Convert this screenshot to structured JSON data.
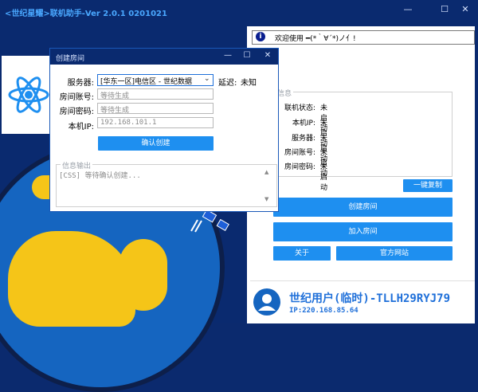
{
  "window": {
    "title": "<世纪星耀>联机助手-Ver 2.0.1 0201021",
    "min": "—",
    "max": "☐",
    "close": "✕"
  },
  "notice": {
    "icon": "i",
    "text": "欢迎使用 ━(*｀∀´*)ノ亻!"
  },
  "info": {
    "title": "信息",
    "rows": [
      {
        "key": "联机状态:",
        "value": "未启动"
      },
      {
        "key": "本机IP:",
        "value": "未启动"
      },
      {
        "key": "服务器:",
        "value": "未启动"
      },
      {
        "key": "房间账号:",
        "value": "未启动"
      },
      {
        "key": "房间密码:",
        "value": "未启动"
      }
    ]
  },
  "buttons": {
    "copy": "一键复制",
    "create_room": "创建房间",
    "join_room": "加入房间",
    "about": "关于",
    "website": "官方网站"
  },
  "user": {
    "name": "世纪用户(临时)-TLLH29RYJ79",
    "ip": "IP:220.168.85.64"
  },
  "dialog": {
    "title": "创建房间",
    "min": "—",
    "max": "☐",
    "close": "✕",
    "server_label": "服务器:",
    "server_value": "[华东一区]电信区 - 世纪数据",
    "latency_label": "延迟:",
    "latency_value": "未知",
    "room_account_label": "房间账号:",
    "room_account_placeholder": "等待生成",
    "room_password_label": "房间密码:",
    "room_password_placeholder": "等待生成",
    "local_ip_label": "本机IP:",
    "local_ip_value": "192.168.101.1",
    "confirm": "确认创建",
    "log_title": "信息输出",
    "log_text": "[CSS] 等待确认创建..."
  },
  "colors": {
    "accent": "#1e8ff0",
    "title_bar": "#0a2a6f",
    "globe": "#1565c0",
    "land": "#f5c518"
  }
}
